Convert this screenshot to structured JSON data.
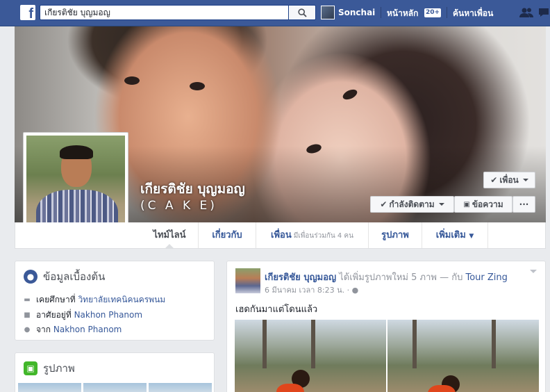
{
  "topbar": {
    "search_value": "เกียรติชัย บุญมอญ",
    "user_name": "Sonchai",
    "home_label": "หน้าหลัก",
    "home_badge": "20+",
    "find_friends_label": "ค้นหาเพื่อน"
  },
  "profile": {
    "name": "เกียรติชัย บุญมอญ",
    "alternate_name": "(C A K E)",
    "friend_button": "เพื่อน",
    "following_button": "กำลังติดตาม",
    "message_button": "ข้อความ",
    "more_button": "···"
  },
  "tabs": [
    {
      "label": "ไทม์ไลน์"
    },
    {
      "label": "เกี่ยวกับ"
    },
    {
      "label": "เพื่อน",
      "sub": "มีเพื่อนร่วมกัน 4 คน"
    },
    {
      "label": "รูปภาพ"
    },
    {
      "label": "เพิ่มเติม"
    }
  ],
  "intro": {
    "title": "ข้อมูลเบื้องต้น",
    "rows": [
      {
        "prefix": "เคยศึกษาที่",
        "link": "วิทยาลัยเทคนิคนครพนม"
      },
      {
        "prefix": "อาศัยอยู่ที่",
        "link": "Nakhon Phanom"
      },
      {
        "prefix": "จาก",
        "link": "Nakhon Phanom"
      }
    ]
  },
  "photos": {
    "title": "รูปภาพ"
  },
  "post": {
    "author": "เกียรติชัย บุญมอญ",
    "action": "ได้เพิ่มรูปภาพใหม่ 5 ภาพ — กับ",
    "with": "Tour Zing",
    "time": "6 มีนาคม เวลา 8:23 น. ·",
    "text": "เฮดกันมาแต่โดนแล้ว"
  },
  "colors": {
    "brand": "#3b5998",
    "link": "#365899",
    "background": "#e9ebee"
  }
}
